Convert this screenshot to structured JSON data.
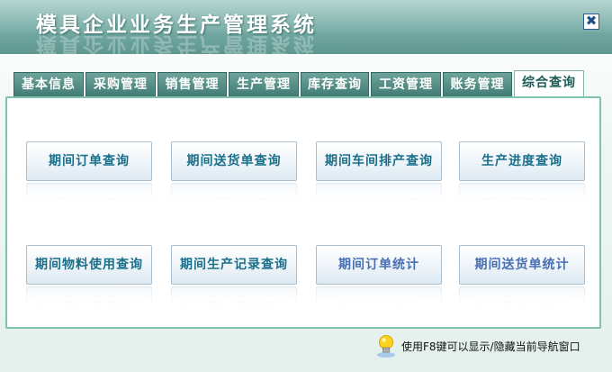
{
  "window": {
    "title": "模具企业业务生产管理系统",
    "close_label": "✖"
  },
  "tabs": [
    {
      "label": "基本信息",
      "active": false
    },
    {
      "label": "采购管理",
      "active": false
    },
    {
      "label": "销售管理",
      "active": false
    },
    {
      "label": "生产管理",
      "active": false
    },
    {
      "label": "库存查询",
      "active": false
    },
    {
      "label": "工资管理",
      "active": false
    },
    {
      "label": "账务管理",
      "active": false
    },
    {
      "label": "综合查询",
      "active": true
    }
  ],
  "buttons": [
    {
      "label": "期间订单查询"
    },
    {
      "label": "期间送货单查询"
    },
    {
      "label": "期间车间排产查询"
    },
    {
      "label": "生产进度查询"
    },
    {
      "label": "期间物料使用查询"
    },
    {
      "label": "期间生产记录查询"
    },
    {
      "label": "期间订单统计"
    },
    {
      "label": "期间送货单统计"
    }
  ],
  "footer": {
    "hint": "使用F8键可以显示/隐藏当前导航窗口",
    "icon": "lightbulb-icon"
  },
  "colors": {
    "titlebar": "#79aea7",
    "tab": "#3f7b73",
    "panel_border": "#7fc2ae",
    "button_text": "#1a6f8a"
  }
}
